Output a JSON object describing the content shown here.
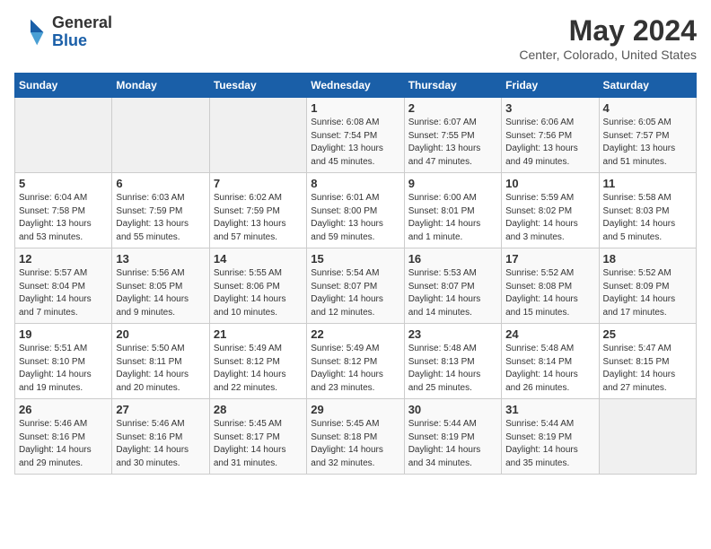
{
  "header": {
    "logo_general": "General",
    "logo_blue": "Blue",
    "title": "May 2024",
    "location": "Center, Colorado, United States"
  },
  "days_of_week": [
    "Sunday",
    "Monday",
    "Tuesday",
    "Wednesday",
    "Thursday",
    "Friday",
    "Saturday"
  ],
  "weeks": [
    {
      "days": [
        {
          "number": "",
          "info": ""
        },
        {
          "number": "",
          "info": ""
        },
        {
          "number": "",
          "info": ""
        },
        {
          "number": "1",
          "info": "Sunrise: 6:08 AM\nSunset: 7:54 PM\nDaylight: 13 hours\nand 45 minutes."
        },
        {
          "number": "2",
          "info": "Sunrise: 6:07 AM\nSunset: 7:55 PM\nDaylight: 13 hours\nand 47 minutes."
        },
        {
          "number": "3",
          "info": "Sunrise: 6:06 AM\nSunset: 7:56 PM\nDaylight: 13 hours\nand 49 minutes."
        },
        {
          "number": "4",
          "info": "Sunrise: 6:05 AM\nSunset: 7:57 PM\nDaylight: 13 hours\nand 51 minutes."
        }
      ]
    },
    {
      "days": [
        {
          "number": "5",
          "info": "Sunrise: 6:04 AM\nSunset: 7:58 PM\nDaylight: 13 hours\nand 53 minutes."
        },
        {
          "number": "6",
          "info": "Sunrise: 6:03 AM\nSunset: 7:59 PM\nDaylight: 13 hours\nand 55 minutes."
        },
        {
          "number": "7",
          "info": "Sunrise: 6:02 AM\nSunset: 7:59 PM\nDaylight: 13 hours\nand 57 minutes."
        },
        {
          "number": "8",
          "info": "Sunrise: 6:01 AM\nSunset: 8:00 PM\nDaylight: 13 hours\nand 59 minutes."
        },
        {
          "number": "9",
          "info": "Sunrise: 6:00 AM\nSunset: 8:01 PM\nDaylight: 14 hours\nand 1 minute."
        },
        {
          "number": "10",
          "info": "Sunrise: 5:59 AM\nSunset: 8:02 PM\nDaylight: 14 hours\nand 3 minutes."
        },
        {
          "number": "11",
          "info": "Sunrise: 5:58 AM\nSunset: 8:03 PM\nDaylight: 14 hours\nand 5 minutes."
        }
      ]
    },
    {
      "days": [
        {
          "number": "12",
          "info": "Sunrise: 5:57 AM\nSunset: 8:04 PM\nDaylight: 14 hours\nand 7 minutes."
        },
        {
          "number": "13",
          "info": "Sunrise: 5:56 AM\nSunset: 8:05 PM\nDaylight: 14 hours\nand 9 minutes."
        },
        {
          "number": "14",
          "info": "Sunrise: 5:55 AM\nSunset: 8:06 PM\nDaylight: 14 hours\nand 10 minutes."
        },
        {
          "number": "15",
          "info": "Sunrise: 5:54 AM\nSunset: 8:07 PM\nDaylight: 14 hours\nand 12 minutes."
        },
        {
          "number": "16",
          "info": "Sunrise: 5:53 AM\nSunset: 8:07 PM\nDaylight: 14 hours\nand 14 minutes."
        },
        {
          "number": "17",
          "info": "Sunrise: 5:52 AM\nSunset: 8:08 PM\nDaylight: 14 hours\nand 15 minutes."
        },
        {
          "number": "18",
          "info": "Sunrise: 5:52 AM\nSunset: 8:09 PM\nDaylight: 14 hours\nand 17 minutes."
        }
      ]
    },
    {
      "days": [
        {
          "number": "19",
          "info": "Sunrise: 5:51 AM\nSunset: 8:10 PM\nDaylight: 14 hours\nand 19 minutes."
        },
        {
          "number": "20",
          "info": "Sunrise: 5:50 AM\nSunset: 8:11 PM\nDaylight: 14 hours\nand 20 minutes."
        },
        {
          "number": "21",
          "info": "Sunrise: 5:49 AM\nSunset: 8:12 PM\nDaylight: 14 hours\nand 22 minutes."
        },
        {
          "number": "22",
          "info": "Sunrise: 5:49 AM\nSunset: 8:12 PM\nDaylight: 14 hours\nand 23 minutes."
        },
        {
          "number": "23",
          "info": "Sunrise: 5:48 AM\nSunset: 8:13 PM\nDaylight: 14 hours\nand 25 minutes."
        },
        {
          "number": "24",
          "info": "Sunrise: 5:48 AM\nSunset: 8:14 PM\nDaylight: 14 hours\nand 26 minutes."
        },
        {
          "number": "25",
          "info": "Sunrise: 5:47 AM\nSunset: 8:15 PM\nDaylight: 14 hours\nand 27 minutes."
        }
      ]
    },
    {
      "days": [
        {
          "number": "26",
          "info": "Sunrise: 5:46 AM\nSunset: 8:16 PM\nDaylight: 14 hours\nand 29 minutes."
        },
        {
          "number": "27",
          "info": "Sunrise: 5:46 AM\nSunset: 8:16 PM\nDaylight: 14 hours\nand 30 minutes."
        },
        {
          "number": "28",
          "info": "Sunrise: 5:45 AM\nSunset: 8:17 PM\nDaylight: 14 hours\nand 31 minutes."
        },
        {
          "number": "29",
          "info": "Sunrise: 5:45 AM\nSunset: 8:18 PM\nDaylight: 14 hours\nand 32 minutes."
        },
        {
          "number": "30",
          "info": "Sunrise: 5:44 AM\nSunset: 8:19 PM\nDaylight: 14 hours\nand 34 minutes."
        },
        {
          "number": "31",
          "info": "Sunrise: 5:44 AM\nSunset: 8:19 PM\nDaylight: 14 hours\nand 35 minutes."
        },
        {
          "number": "",
          "info": ""
        }
      ]
    }
  ]
}
